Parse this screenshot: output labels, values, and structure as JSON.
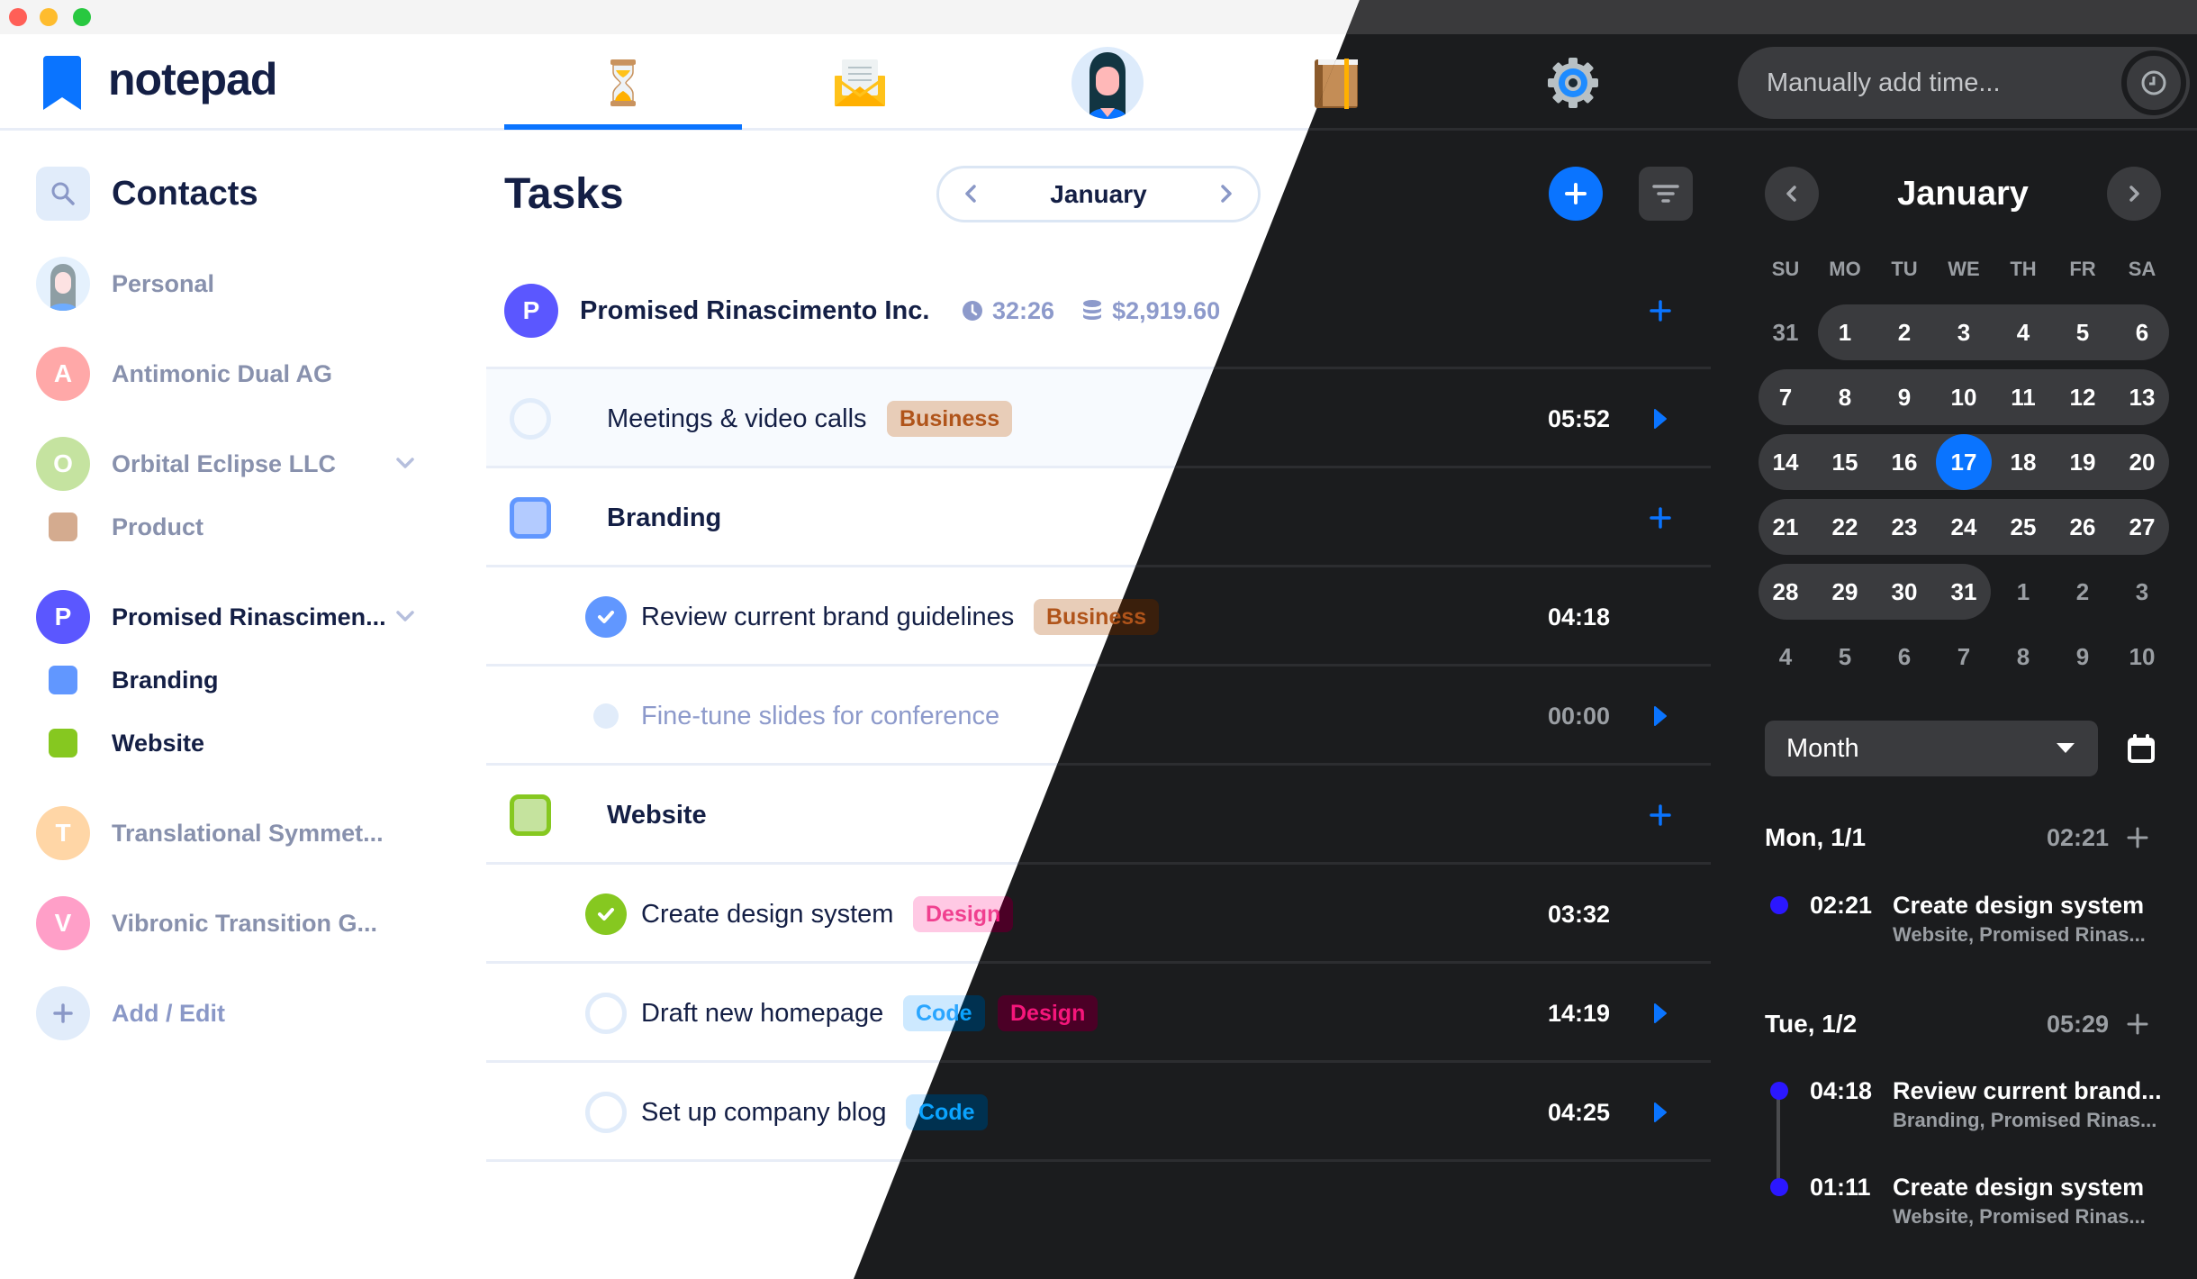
{
  "app": {
    "name": "notepad"
  },
  "header": {
    "tabs": [
      {
        "name": "time-tracking",
        "icon": "hourglass-icon",
        "active": true
      },
      {
        "name": "mail",
        "icon": "envelope-icon",
        "active": false
      },
      {
        "name": "contacts",
        "icon": "avatar-icon",
        "active": false
      },
      {
        "name": "notebook",
        "icon": "notebook-icon",
        "active": false
      },
      {
        "name": "settings",
        "icon": "gear-icon",
        "active": false
      }
    ],
    "time_input": {
      "placeholder": "Manually add time..."
    }
  },
  "sidebar": {
    "title": "Contacts",
    "items": [
      {
        "label": "Personal",
        "type": "avatar-image",
        "active": false
      },
      {
        "label": "Antimonic Dual AG",
        "initial": "A",
        "color": "#ffa8a8",
        "active": false
      },
      {
        "label": "Orbital Eclipse LLC",
        "initial": "O",
        "color": "#c5e3a0",
        "active": false,
        "expandable": true
      },
      {
        "label": "Product",
        "type": "project",
        "color": "#d4ab8f",
        "active": false
      },
      {
        "label": "Promised Rinascimen...",
        "initial": "P",
        "color": "#5b57ff",
        "active": true,
        "expandable": true
      },
      {
        "label": "Branding",
        "type": "project",
        "color": "#6197ff",
        "active": true
      },
      {
        "label": "Website",
        "type": "project",
        "color": "#86c820",
        "active": true
      },
      {
        "label": "Translational Symmet...",
        "initial": "T",
        "color": "#ffd6a6",
        "active": false
      },
      {
        "label": "Vibronic Transition G...",
        "initial": "V",
        "color": "#ff9fc8",
        "active": false
      },
      {
        "label": "Add / Edit",
        "type": "add",
        "active": false
      }
    ]
  },
  "tasks": {
    "title": "Tasks",
    "month": "January",
    "client": {
      "initial": "P",
      "name": "Promised Rinascimento Inc.",
      "hours": "32:26",
      "amount": "$2,919.60"
    },
    "rows": [
      {
        "kind": "task",
        "name": "Meetings & video calls",
        "tags": [
          "Business"
        ],
        "time": "05:52",
        "status": "open",
        "play": true,
        "highlighted": true
      },
      {
        "kind": "project",
        "name": "Branding",
        "color": "#6197ff"
      },
      {
        "kind": "task",
        "name": "Review current brand guidelines",
        "tags": [
          "Business"
        ],
        "time": "04:18",
        "status": "done-blue",
        "play": false
      },
      {
        "kind": "task",
        "name": "Fine-tune slides for conference",
        "tags": [],
        "time": "00:00",
        "status": "pending",
        "play": true
      },
      {
        "kind": "project",
        "name": "Website",
        "color": "#86c820"
      },
      {
        "kind": "task",
        "name": "Create design system",
        "tags": [
          "Design"
        ],
        "time": "03:32",
        "status": "done-green",
        "play": false
      },
      {
        "kind": "task",
        "name": "Draft new homepage",
        "tags": [
          "Code",
          "Design"
        ],
        "time": "14:19",
        "status": "open",
        "play": true
      },
      {
        "kind": "task",
        "name": "Set up company blog",
        "tags": [
          "Code"
        ],
        "time": "04:25",
        "status": "open",
        "play": true
      }
    ]
  },
  "calendar": {
    "month": "January",
    "weekdays": [
      "SU",
      "MO",
      "TU",
      "WE",
      "TH",
      "FR",
      "SA"
    ],
    "weeks": [
      [
        "31",
        "1",
        "2",
        "3",
        "4",
        "5",
        "6"
      ],
      [
        "7",
        "8",
        "9",
        "10",
        "11",
        "12",
        "13"
      ],
      [
        "14",
        "15",
        "16",
        "17",
        "18",
        "19",
        "20"
      ],
      [
        "21",
        "22",
        "23",
        "24",
        "25",
        "26",
        "27"
      ],
      [
        "28",
        "29",
        "30",
        "31",
        "1",
        "2",
        "3"
      ],
      [
        "4",
        "5",
        "6",
        "7",
        "8",
        "9",
        "10"
      ]
    ],
    "selected_day": "17",
    "view_select": "Month",
    "days": [
      {
        "label": "Mon, 1/1",
        "total": "02:21",
        "entries": [
          {
            "time": "02:21",
            "task": "Create design system",
            "sub": "Website, Promised Rinas..."
          }
        ]
      },
      {
        "label": "Tue, 1/2",
        "total": "05:29",
        "entries": [
          {
            "time": "04:18",
            "task": "Review current brand...",
            "sub": "Branding, Promised Rinas..."
          },
          {
            "time": "01:11",
            "task": "Create design system",
            "sub": "Website, Promised Rinas..."
          }
        ]
      }
    ]
  },
  "colors": {
    "accent": "#0a74ff",
    "brand_text": "#141f45",
    "dark_bg": "#1b1c1e",
    "timeline_dot": "#2b17ff"
  }
}
